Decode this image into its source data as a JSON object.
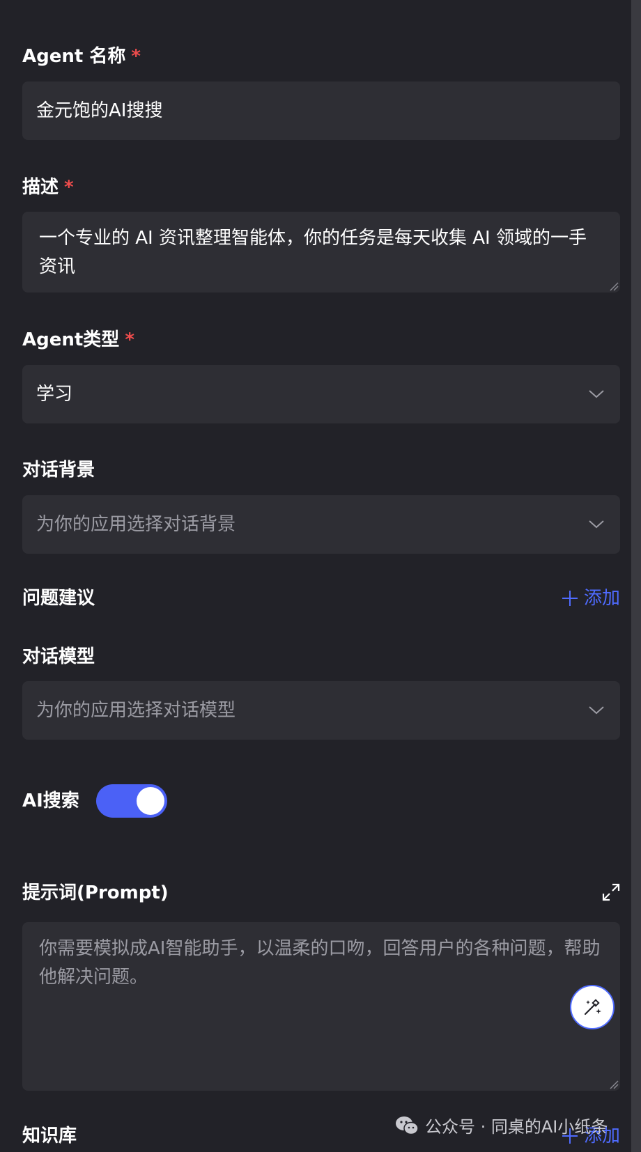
{
  "form": {
    "agent_name": {
      "label": "Agent 名称",
      "required_mark": "*",
      "value": "金元饱的AI搜搜"
    },
    "description": {
      "label": "描述",
      "required_mark": "*",
      "value": "一个专业的 AI 资讯整理智能体，你的任务是每天收集 AI 领域的一手资讯"
    },
    "agent_type": {
      "label": "Agent类型",
      "required_mark": "*",
      "selected": "学习"
    },
    "chat_background": {
      "label": "对话背景",
      "placeholder": "为你的应用选择对话背景"
    },
    "question_suggestions": {
      "label": "问题建议",
      "add_label": "添加"
    },
    "chat_model": {
      "label": "对话模型",
      "placeholder": "为你的应用选择对话模型"
    },
    "ai_search": {
      "label": "AI搜索",
      "enabled": true
    },
    "prompt": {
      "label": "提示词(Prompt)",
      "placeholder": "你需要模拟成AI智能助手，以温柔的口吻，回答用户的各种问题，帮助他解决问题。"
    },
    "knowledge_base": {
      "label": "知识库",
      "add_label": "添加"
    }
  },
  "watermark": {
    "text": "公众号 · 同桌的AI小纸条"
  },
  "colors": {
    "background": "#222228",
    "field": "#2e2e34",
    "accent": "#4f6bff",
    "toggle_on": "#4b61f6",
    "required": "#ef4d4d",
    "placeholder": "#9b9ba3"
  },
  "icons": [
    "chevron-down-icon",
    "plus-icon",
    "expand-icon",
    "magic-wand-icon",
    "resize-handle-icon",
    "wechat-icon"
  ]
}
